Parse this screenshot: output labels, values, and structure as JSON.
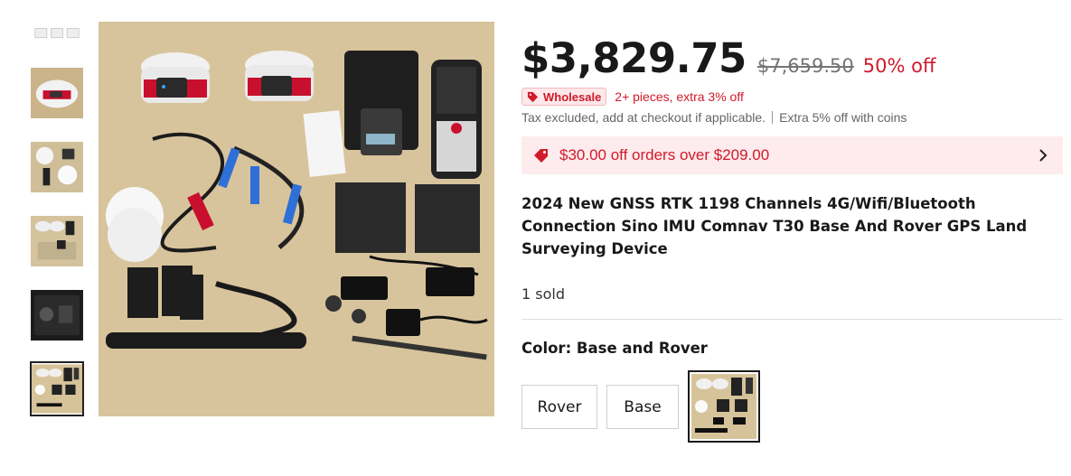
{
  "gallery": {
    "thumbnails": [
      {
        "name": "thumb-accessories-strip"
      },
      {
        "name": "thumb-receiver-closeup"
      },
      {
        "name": "thumb-kit-components"
      },
      {
        "name": "thumb-full-kit"
      },
      {
        "name": "thumb-carry-case"
      },
      {
        "name": "thumb-base-and-rover-kit",
        "selected": true
      }
    ]
  },
  "product": {
    "price": "$3,829.75",
    "original_price": "$7,659.50",
    "discount": "50% off",
    "wholesale_badge": "Wholesale",
    "wholesale_note": "2+ pieces, extra 3% off",
    "tax_note": "Tax excluded, add at checkout if applicable.",
    "coins_note": "Extra 5% off with coins",
    "coupon_text": "$30.00 off orders over $209.00",
    "title": "2024 New GNSS RTK 1198 Channels 4G/Wifi/Bluetooth Connection Sino IMU Comnav T30 Base And Rover GPS Land Surveying Device",
    "sold": "1 sold",
    "color_label": "Color: Base and Rover",
    "variants": [
      "Rover",
      "Base"
    ]
  },
  "colors": {
    "accent_red": "#d11a2a",
    "coupon_bg": "#fdebed",
    "text": "#191919"
  }
}
